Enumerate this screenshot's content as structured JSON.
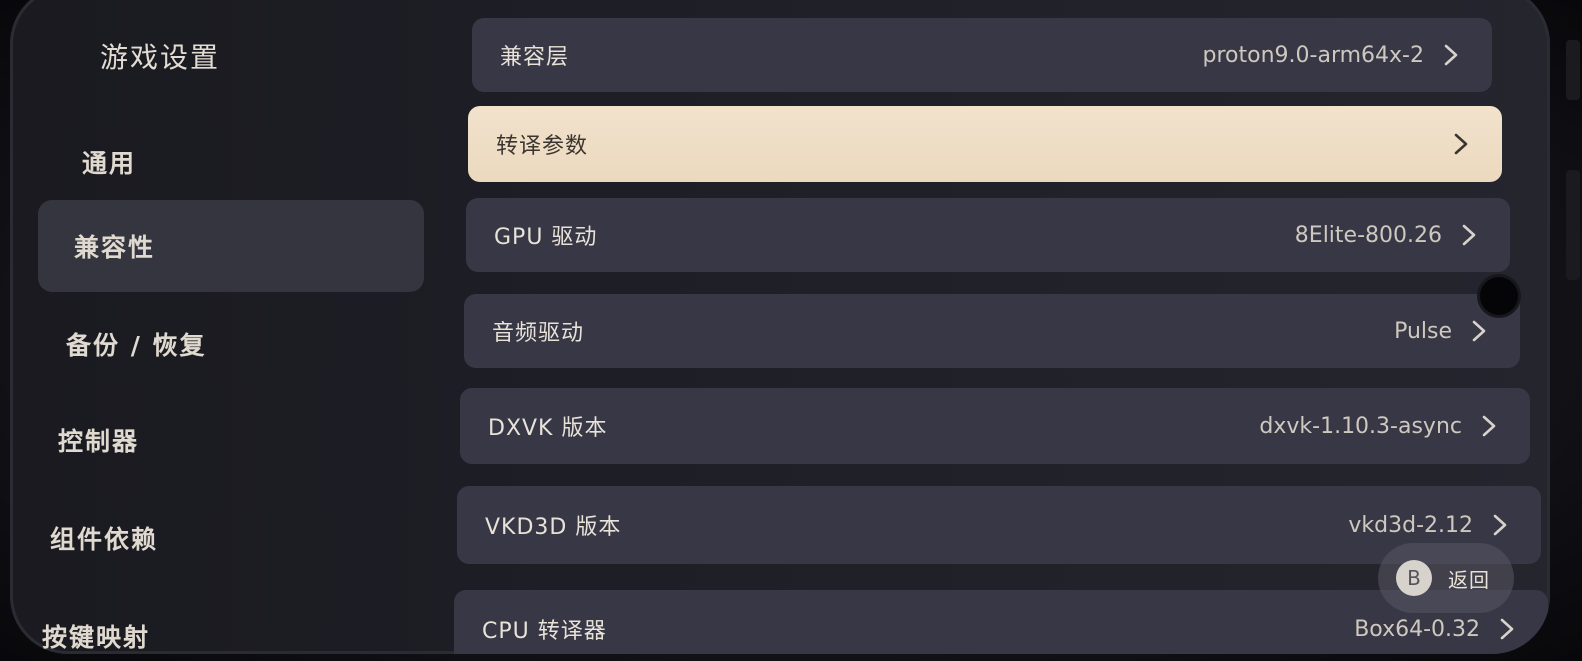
{
  "sidebar": {
    "title": "游戏设置",
    "items": [
      {
        "label": "通用"
      },
      {
        "label": "兼容性"
      },
      {
        "label": "备份 / 恢复"
      },
      {
        "label": "控制器"
      },
      {
        "label": "组件依赖"
      },
      {
        "label": "按键映射"
      }
    ],
    "active_index": 1
  },
  "settings": {
    "rows": [
      {
        "label": "兼容层",
        "value": "proton9.0-arm64x-2"
      },
      {
        "label": "转译参数",
        "value": ""
      },
      {
        "label": "GPU 驱动",
        "value": "8Elite-800.26"
      },
      {
        "label": "音频驱动",
        "value": "Pulse"
      },
      {
        "label": "DXVK 版本",
        "value": "dxvk-1.10.3-async"
      },
      {
        "label": "VKD3D 版本",
        "value": "vkd3d-2.12"
      },
      {
        "label": "CPU 转译器",
        "value": "Box64-0.32"
      }
    ],
    "highlighted_index": 1
  },
  "back_hint": {
    "button": "B",
    "label": "返回"
  },
  "colors": {
    "row_bg": "#373745",
    "highlight_bg": "#f2e2cc",
    "sidebar_active_bg": "#35353f",
    "text": "#e8e2d8"
  }
}
